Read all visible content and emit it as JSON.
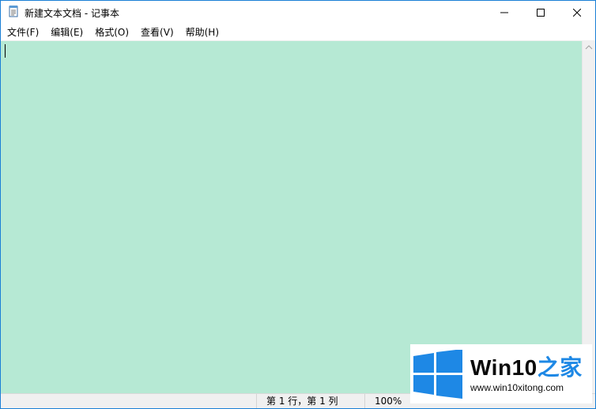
{
  "window": {
    "title": "新建文本文档 - 记事本",
    "icons": {
      "app": "notepad-icon",
      "minimize": "minimize-icon",
      "maximize": "maximize-icon",
      "close": "close-icon"
    }
  },
  "menu": {
    "file": "文件(F)",
    "edit": "编辑(E)",
    "format": "格式(O)",
    "view": "查看(V)",
    "help": "帮助(H)"
  },
  "editor": {
    "content": "",
    "background_color": "#b6e9d4"
  },
  "status": {
    "position": "第 1 行，第 1 列",
    "zoom": "100%"
  },
  "watermark": {
    "brand_prefix": "Win10",
    "brand_suffix": "之家",
    "url": "www.win10xitong.com",
    "accent_color": "#1e88e5"
  }
}
